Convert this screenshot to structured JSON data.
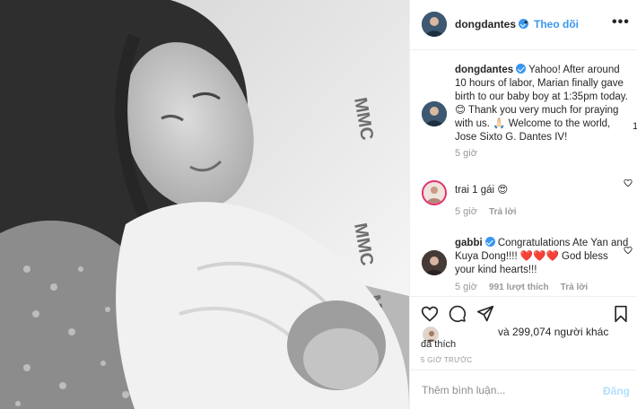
{
  "photo": {
    "icon": "photo-image",
    "alt": ""
  },
  "header": {
    "username": "dongdantes",
    "separator": "•",
    "follow_label": "Theo dõi",
    "more_label": "•••"
  },
  "caption": {
    "username": "dongdantes",
    "text": "Yahoo! After around 10 hours of labor, Marian finally gave birth to our baby boy at 1:35pm today. 😊 Thank you very much for praying with us. 🙏🏻 Welcome to the world, Jose Sixto G. Dantes IV!",
    "time": "5 giờ"
  },
  "comments": [
    {
      "username": "",
      "text": "trai 1 gái 😍",
      "time": "5 giờ",
      "likes": "",
      "reply": "Trả lời"
    },
    {
      "username": "gabbi",
      "text": "Congratulations Ate Yan and Kuya Dong!!!! ❤️❤️❤️ God bless your kind hearts!!!",
      "time": "5 giờ",
      "likes": "991 lượt thích",
      "reply": "Trả lời"
    }
  ],
  "scroll_counter": "1",
  "likes": {
    "count_text": "và 299,074 người khác",
    "suffix": "đã thích"
  },
  "post_time": "5 GIỜ TRƯỚC",
  "add_comment": {
    "placeholder": "Thêm bình luận...",
    "post_label": "Đăng"
  },
  "colors": {
    "accent": "#3897f0",
    "muted": "#999999",
    "post_disabled": "#b2dffc",
    "border": "#efefef"
  }
}
